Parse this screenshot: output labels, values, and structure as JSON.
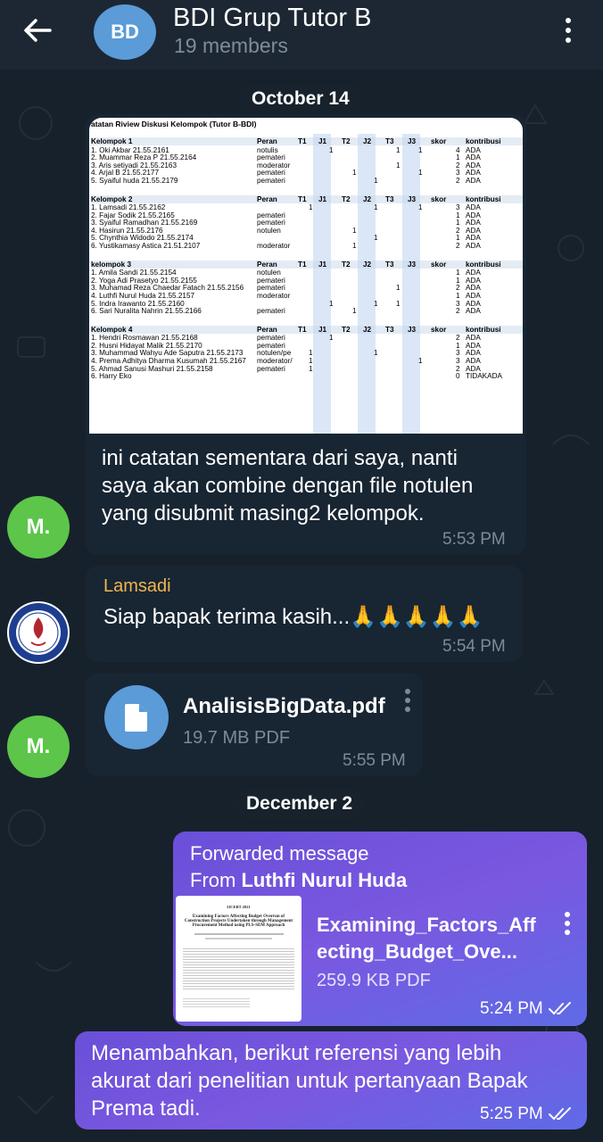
{
  "header": {
    "avatar_initials": "BD",
    "title": "BDI Grup Tutor B",
    "subtitle": "19 members"
  },
  "dates": {
    "first": "October 14",
    "second": "December 2"
  },
  "messages": {
    "m1": {
      "sender_initials": "M.",
      "text_lines": [
        "ini catatan sementara dari saya, nanti",
        "saya akan combine dengan file notulen",
        "yang disubmit masing2 kelompok."
      ],
      "time": "5:53 PM"
    },
    "m2": {
      "sender_name": "Lamsadi",
      "text": "Siap bapak terima kasih...🙏🙏🙏🙏🙏",
      "time": "5:54 PM"
    },
    "m3": {
      "sender_initials": "M.",
      "file_name": "AnalisisBigData.pdf",
      "file_size": "19.7 MB PDF",
      "time": "5:55 PM"
    },
    "m4": {
      "forwarded_label": "Forwarded message",
      "from_prefix": "From",
      "from_name": "Luthfi Nurul Huda",
      "file_name_line1": "Examining_Factors_Aff",
      "file_name_line2": "ecting_Budget_Ove...",
      "file_size": "259.9 KB PDF",
      "time": "5:24 PM"
    },
    "m5": {
      "text_lines": [
        "Menambahkan, berikut referensi yang lebih",
        "akurat dari penelitian untuk pertanyaan Bapak",
        "Prema tadi."
      ],
      "time": "5:25 PM"
    }
  },
  "sheet": {
    "title": "atatan Riview Diskusi Kelompok (Tutor B-BDI)",
    "headers": [
      "Peran",
      "T1",
      "J1",
      "T2",
      "J2",
      "T3",
      "J3",
      "skor",
      "kontribusi"
    ],
    "groups": [
      {
        "name": "Kelompok 1",
        "rows": [
          [
            "1. Oki Akbar 21.55.2161",
            "notulis",
            "",
            "1",
            "",
            "",
            "1",
            "1",
            "4",
            "ADA"
          ],
          [
            "2. Muammar Reza P 21.55.2164",
            "pemateri",
            "",
            "",
            "",
            "",
            "",
            "",
            "1",
            "ADA"
          ],
          [
            "3. Aris setiyadi 21.55.2163",
            "moderator",
            "",
            "",
            "",
            "",
            "1",
            "",
            "2",
            "ADA"
          ],
          [
            "4. Arjal B 21.55.2177",
            "pemateri",
            "",
            "",
            "1",
            "",
            "",
            "1",
            "3",
            "ADA"
          ],
          [
            "5. Syaiful huda 21.55.2179",
            "pemateri",
            "",
            "",
            "",
            "1",
            "",
            "",
            "2",
            "ADA"
          ]
        ]
      },
      {
        "name": "Kelompok 2",
        "rows": [
          [
            "1. Lamsadi 21.55.2162",
            "",
            "1",
            "",
            "",
            "1",
            "",
            "1",
            "3",
            "ADA"
          ],
          [
            "2. Fajar Sodik 21.55.2165",
            "pemateri",
            "",
            "",
            "",
            "",
            "",
            "",
            "1",
            "ADA"
          ],
          [
            "3. Syaiful Ramadhan 21.55.2169",
            "pemateri",
            "",
            "",
            "",
            "",
            "",
            "",
            "1",
            "ADA"
          ],
          [
            "4. Hasirun 21.55.2176",
            "notulen",
            "",
            "",
            "1",
            "",
            "",
            "",
            "2",
            "ADA"
          ],
          [
            "5. Chynthia Widodo 21.55.2174",
            "",
            "",
            "",
            "",
            "1",
            "",
            "",
            "1",
            "ADA"
          ],
          [
            "6. Yustikamasy Astica 21.51.2107",
            "moderator",
            "",
            "",
            "1",
            "",
            "",
            "",
            "2",
            "ADA"
          ]
        ]
      },
      {
        "name": "kelompok 3",
        "rows": [
          [
            "1. Amila Sandi 21.55.2154",
            "notulen",
            "",
            "",
            "",
            "",
            "",
            "",
            "1",
            "ADA"
          ],
          [
            "2. Yoga Adi Prasetyo 21.55.2155",
            "pemateri",
            "",
            "",
            "",
            "",
            "",
            "",
            "1",
            "ADA"
          ],
          [
            "3. Muhamad Reza Chaedar Fatach 21.55.2156",
            "pemateri",
            "",
            "",
            "",
            "",
            "1",
            "",
            "2",
            "ADA"
          ],
          [
            "4. Luthfi Nurul Huda 21.55.2157",
            "moderator",
            "",
            "",
            "",
            "",
            "",
            "",
            "1",
            "ADA"
          ],
          [
            "5. Indra Irawanto 21.55.2160",
            "",
            "",
            "1",
            "",
            "1",
            "1",
            "",
            "3",
            "ADA"
          ],
          [
            "6. Sari Nuralita Nahrin 21.55.2166",
            "pemateri",
            "",
            "",
            "1",
            "",
            "",
            "",
            "2",
            "ADA"
          ]
        ]
      },
      {
        "name": "Kelompok 4",
        "rows": [
          [
            "1. Hendri Rosmawan 21.55.2168",
            "pemateri",
            "",
            "1",
            "",
            "",
            "",
            "",
            "2",
            "ADA"
          ],
          [
            "2. Husni Hidayat Malik 21.55.2170",
            "pemateri",
            "",
            "",
            "",
            "",
            "",
            "",
            "1",
            "ADA"
          ],
          [
            "3. Muhammad Wahyu Ade Saputra 21.55.2173",
            "notulen/pe",
            "1",
            "",
            "",
            "1",
            "",
            "",
            "3",
            "ADA"
          ],
          [
            "4. Prema Adhitya Dharma Kusumah 21.55.2167",
            "moderator/",
            "1",
            "",
            "",
            "",
            "",
            "1",
            "3",
            "ADA"
          ],
          [
            "5. Ahmad Sanusi Mashuri 21.55.2158",
            "pemateri",
            "1",
            "",
            "",
            "",
            "",
            "",
            "2",
            "ADA"
          ],
          [
            "6. Harry Eko",
            "",
            "",
            "",
            "",
            "",
            "",
            "",
            "0",
            "TIDAKADA"
          ]
        ]
      }
    ]
  },
  "pdf_thumb": {
    "lines": [
      "IJCERT 2021",
      "Examining Factors Affecting Budget Overrun of",
      "Construction Projects Undertaken through Management",
      "Procurement Method using PLS-SEM Approach"
    ]
  },
  "colors": {
    "header_bg": "#1c2733",
    "chat_bg": "#17212b",
    "bubble_in": "#182533",
    "bubble_out": "#7a58e0",
    "accent_name": "#f0b64d",
    "avatar_green": "#5cc54a",
    "avatar_blue": "#5a9bd8"
  }
}
